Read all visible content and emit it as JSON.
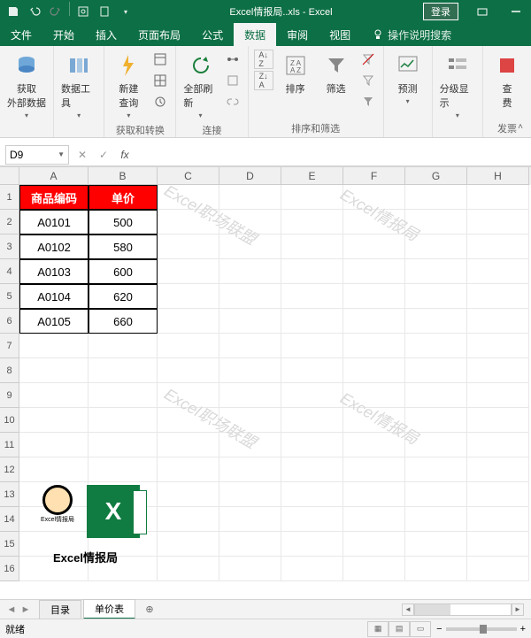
{
  "titlebar": {
    "filename": "Excel情报局..xls - Excel",
    "login": "登录"
  },
  "tabs": {
    "file": "文件",
    "home": "开始",
    "insert": "插入",
    "layout": "页面布局",
    "formulas": "公式",
    "data": "数据",
    "review": "审阅",
    "view": "视图",
    "tell": "操作说明搜索"
  },
  "ribbon": {
    "group1": {
      "label": "获取\n外部数据",
      "btn": "获取\n外部数据"
    },
    "group2": {
      "btn": "数据工具"
    },
    "group3": {
      "label": "获取和转换",
      "btn": "新建\n查询"
    },
    "group4": {
      "label": "连接",
      "btn": "全部刷新"
    },
    "group5": {
      "label": "排序和筛选",
      "sort": "排序",
      "filter": "筛选"
    },
    "group6": {
      "btn": "预测"
    },
    "group7": {
      "btn": "分级显示"
    },
    "group8": {
      "label": "发票",
      "btn": "查\n费"
    }
  },
  "namebox": "D9",
  "columns": [
    "A",
    "B",
    "C",
    "D",
    "E",
    "F",
    "G",
    "H"
  ],
  "table": {
    "h1": "商品编码",
    "h2": "单价",
    "rows": [
      {
        "code": "A0101",
        "price": "500"
      },
      {
        "code": "A0102",
        "price": "580"
      },
      {
        "code": "A0103",
        "price": "600"
      },
      {
        "code": "A0104",
        "price": "620"
      },
      {
        "code": "A0105",
        "price": "660"
      }
    ]
  },
  "watermark": "Excel职场联盟",
  "watermark2": "Excel情报局",
  "logo_caption": "Excel情报局",
  "avatar_caption": "Excel情报局",
  "sheets": {
    "s1": "目录",
    "s2": "单价表"
  },
  "status": {
    "ready": "就绪",
    "zoom": ""
  }
}
